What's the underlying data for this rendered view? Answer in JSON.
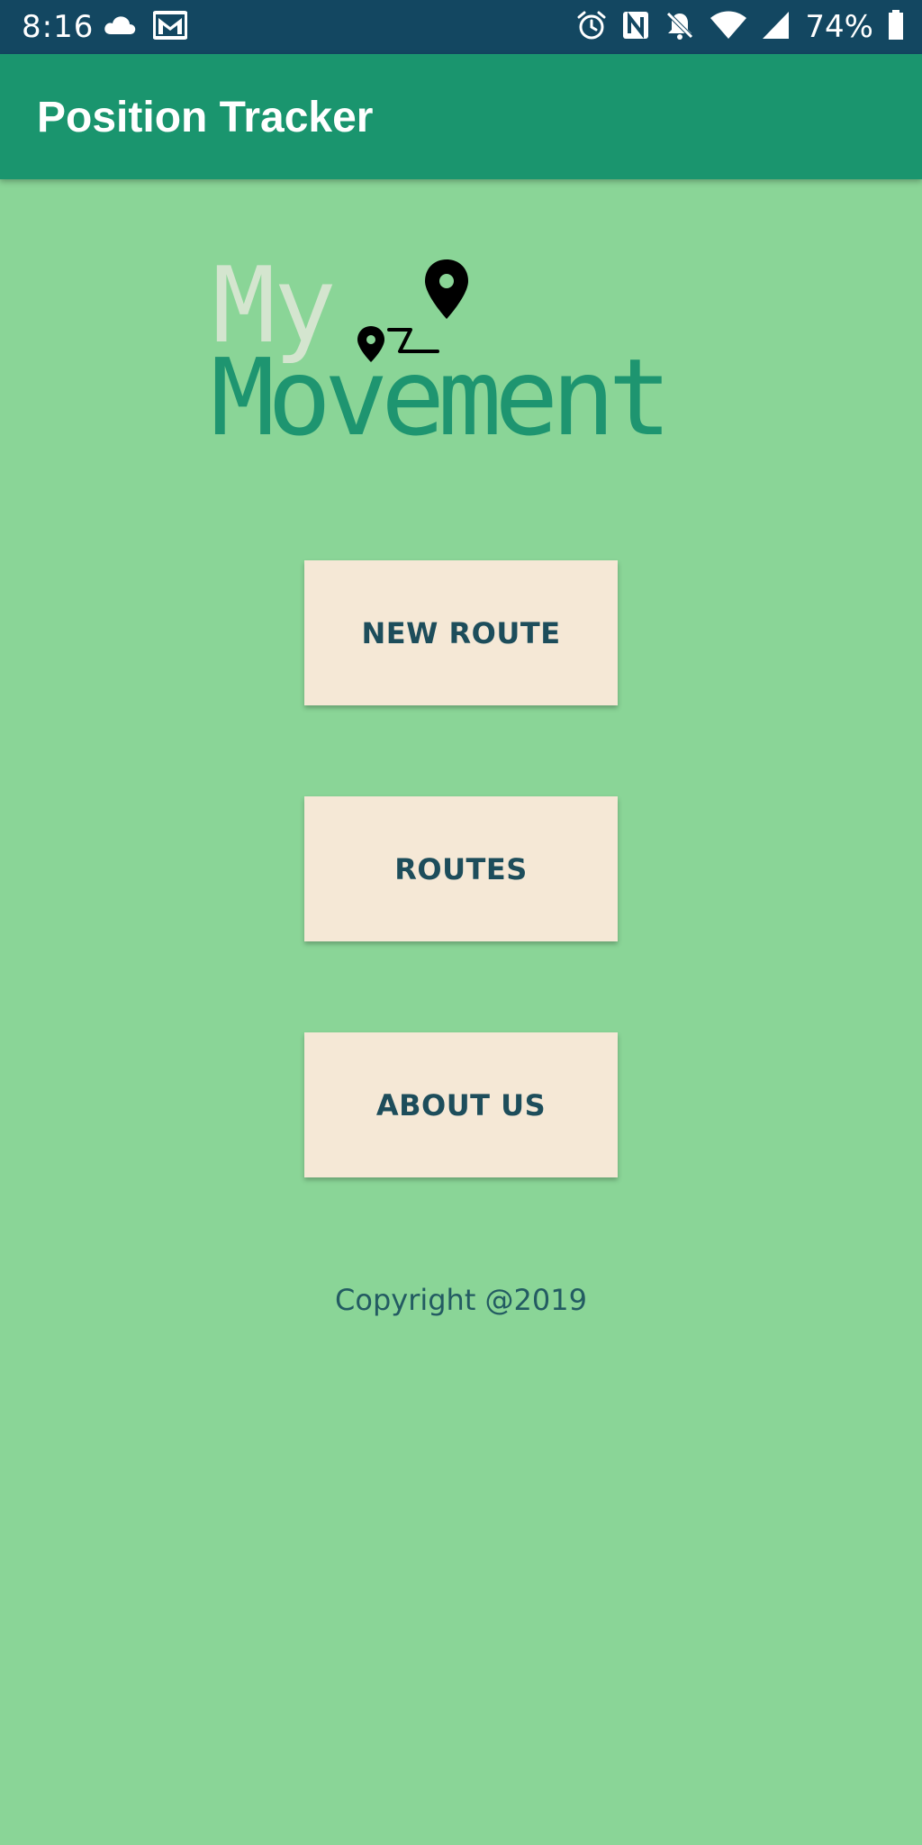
{
  "status_bar": {
    "time": "8:16",
    "battery_percent": "74%",
    "left_icons": [
      "cloud-icon",
      "gmail-icon"
    ],
    "right_icons": [
      "alarm-icon",
      "nfc-icon",
      "notifications-off-icon",
      "wifi-icon",
      "signal-icon",
      "battery-icon"
    ]
  },
  "app_bar": {
    "title": "Position Tracker"
  },
  "logo": {
    "line1": "My",
    "line2": "Movement"
  },
  "menu": {
    "new_route_label": "NEW ROUTE",
    "routes_label": "ROUTES",
    "about_us_label": "ABOUT US"
  },
  "footer": {
    "copyright": "Copyright @2019"
  },
  "colors": {
    "status_bar": "#134761",
    "app_bar": "#1a956e",
    "background": "#8ad597",
    "button_bg": "#f5e8d6",
    "button_text": "#1d4d5b",
    "logo_primary": "#1e9570",
    "logo_secondary": "#d4e5cf"
  }
}
